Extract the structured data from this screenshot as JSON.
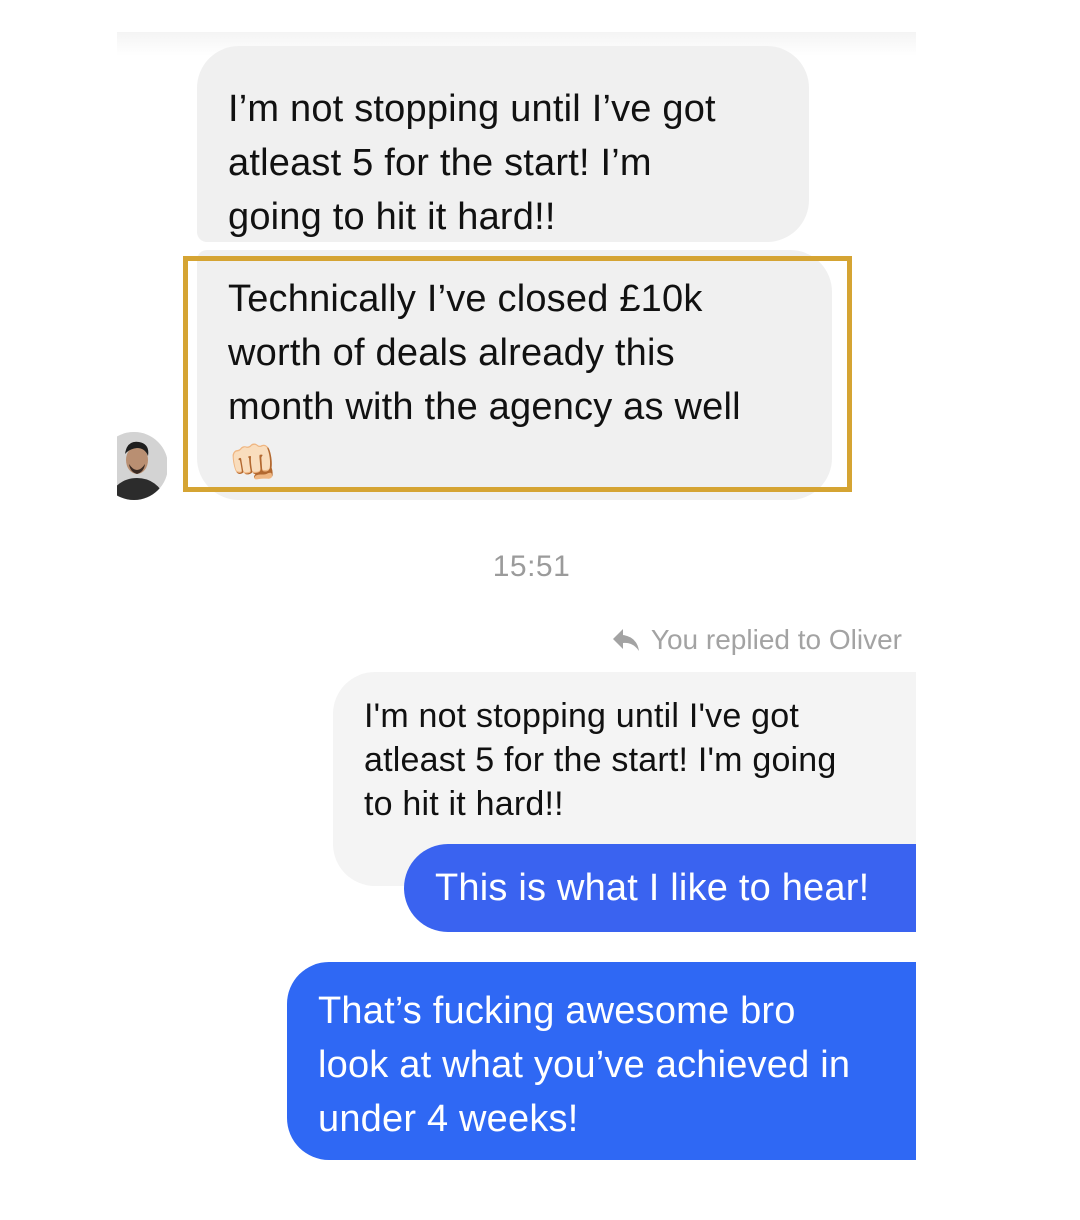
{
  "conversation": {
    "incoming": {
      "message_1": {
        "lines": [
          "I’m not stopping until I’ve got",
          "atleast 5 for the start! I’m",
          "going to hit it hard!!"
        ]
      },
      "message_2": {
        "lines": [
          "Technically I’ve closed £10k",
          "worth of deals already this",
          "month with the agency as well"
        ],
        "emoji": "👊🏻",
        "highlighted": true
      },
      "avatar_icon": "contact-avatar-photo"
    },
    "timestamp": "15:51",
    "reply_indicator": {
      "icon": "reply-arrow-icon",
      "text": "You replied to Oliver"
    },
    "quoted_message": {
      "lines": [
        "I'm not stopping until I've got",
        "atleast 5 for the start! I'm going",
        "to hit it hard!!"
      ]
    },
    "outgoing": {
      "reply_1": "This is what I like to hear!",
      "message_2": {
        "lines": [
          "That’s fucking awesome bro",
          "look at what you’ve achieved in",
          "under 4 weeks!"
        ]
      }
    }
  },
  "colors": {
    "incoming_bubble": "#f0f0f0",
    "outgoing_bubble": "#3a63f0",
    "outgoing_bubble_alt": "#2f68f4",
    "highlight_border": "#d5a433",
    "timestamp_text": "#9b9b9b",
    "reply_indicator_text": "#a3a3a3"
  }
}
